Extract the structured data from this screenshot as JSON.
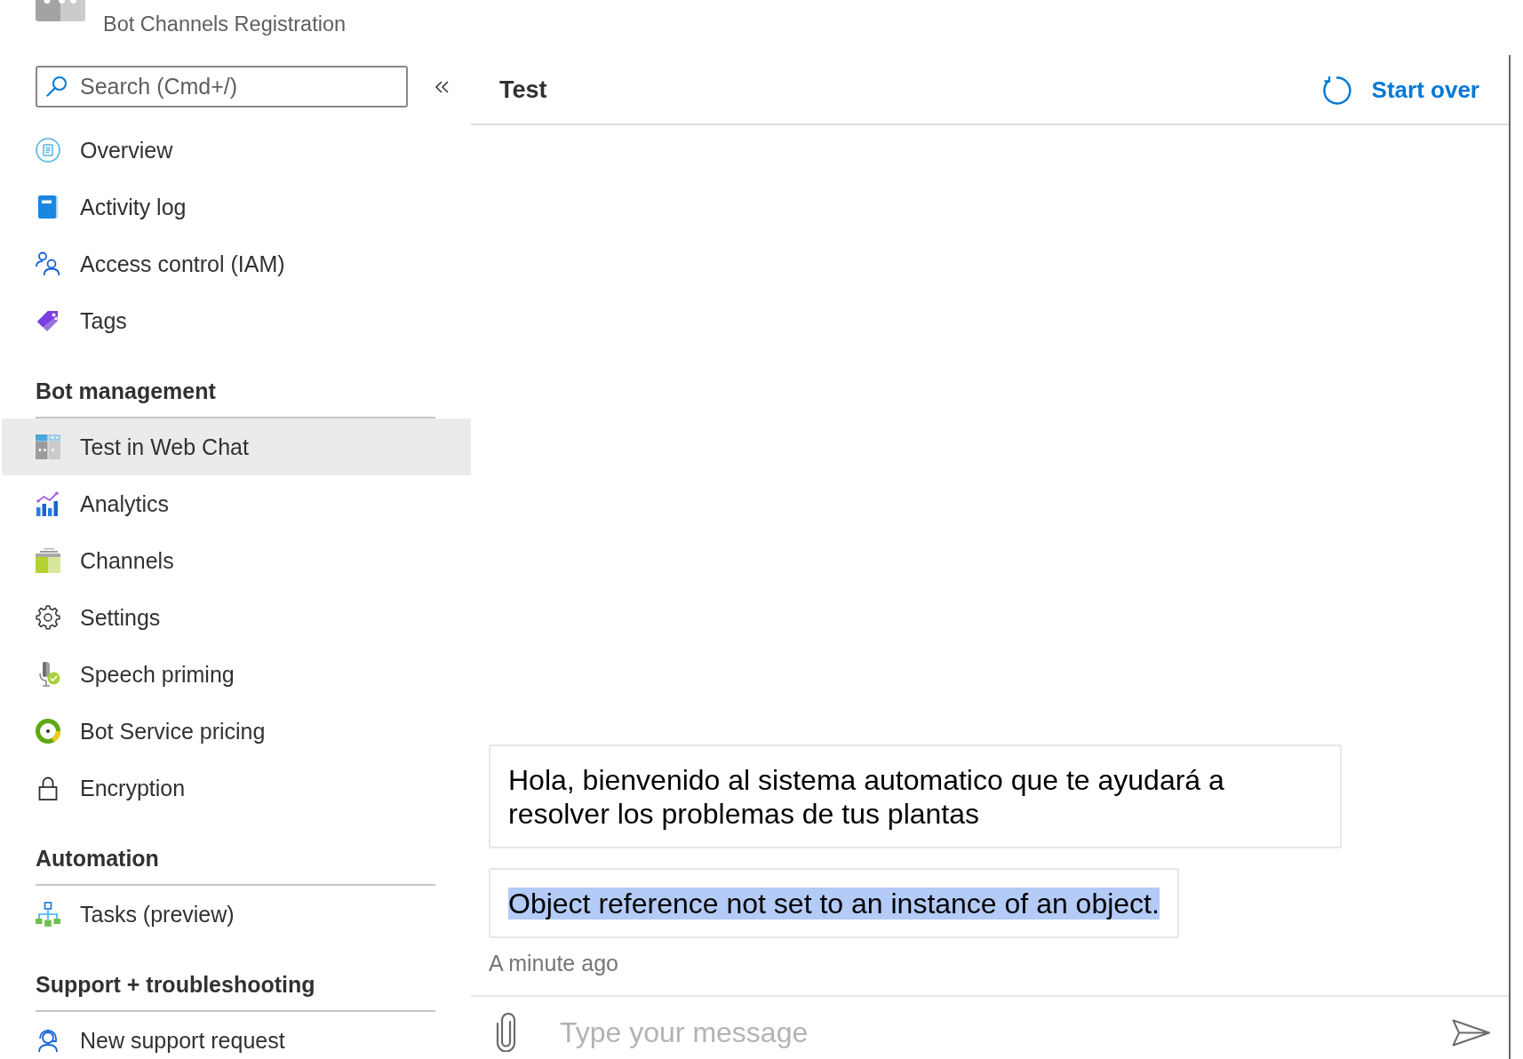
{
  "resource": {
    "subtitle": "Bot Channels Registration"
  },
  "sidebar": {
    "search": {
      "placeholder": "Search (Cmd+/)"
    },
    "sections": [
      {
        "items": [
          {
            "kind": "overview",
            "label": "Overview",
            "selected": false
          },
          {
            "kind": "activity",
            "label": "Activity log",
            "selected": false
          },
          {
            "kind": "access",
            "label": "Access control (IAM)",
            "selected": false
          },
          {
            "kind": "tags",
            "label": "Tags",
            "selected": false
          }
        ]
      },
      {
        "heading": "Bot management",
        "items": [
          {
            "kind": "webchat",
            "label": "Test in Web Chat",
            "selected": true
          },
          {
            "kind": "analytics",
            "label": "Analytics",
            "selected": false
          },
          {
            "kind": "channels",
            "label": "Channels",
            "selected": false
          },
          {
            "kind": "settings",
            "label": "Settings",
            "selected": false
          },
          {
            "kind": "speech",
            "label": "Speech priming",
            "selected": false
          },
          {
            "kind": "pricing",
            "label": "Bot Service pricing",
            "selected": false
          },
          {
            "kind": "encryption",
            "label": "Encryption",
            "selected": false
          }
        ]
      },
      {
        "heading": "Automation",
        "items": [
          {
            "kind": "tasks",
            "label": "Tasks (preview)",
            "selected": false
          }
        ]
      },
      {
        "heading": "Support + troubleshooting",
        "items": [
          {
            "kind": "support",
            "label": "New support request",
            "selected": false
          }
        ]
      }
    ]
  },
  "panel": {
    "title": "Test",
    "start_over": "Start over",
    "messages": [
      {
        "text": "Hola, bienvenido al sistema automatico que te ayudará a resolver los problemas de tus plantas",
        "highlighted": false
      },
      {
        "text": "Object reference not set to an instance of an object.",
        "highlighted": true
      }
    ],
    "timestamp": "A minute ago",
    "composer": {
      "placeholder": "Type your message"
    }
  }
}
